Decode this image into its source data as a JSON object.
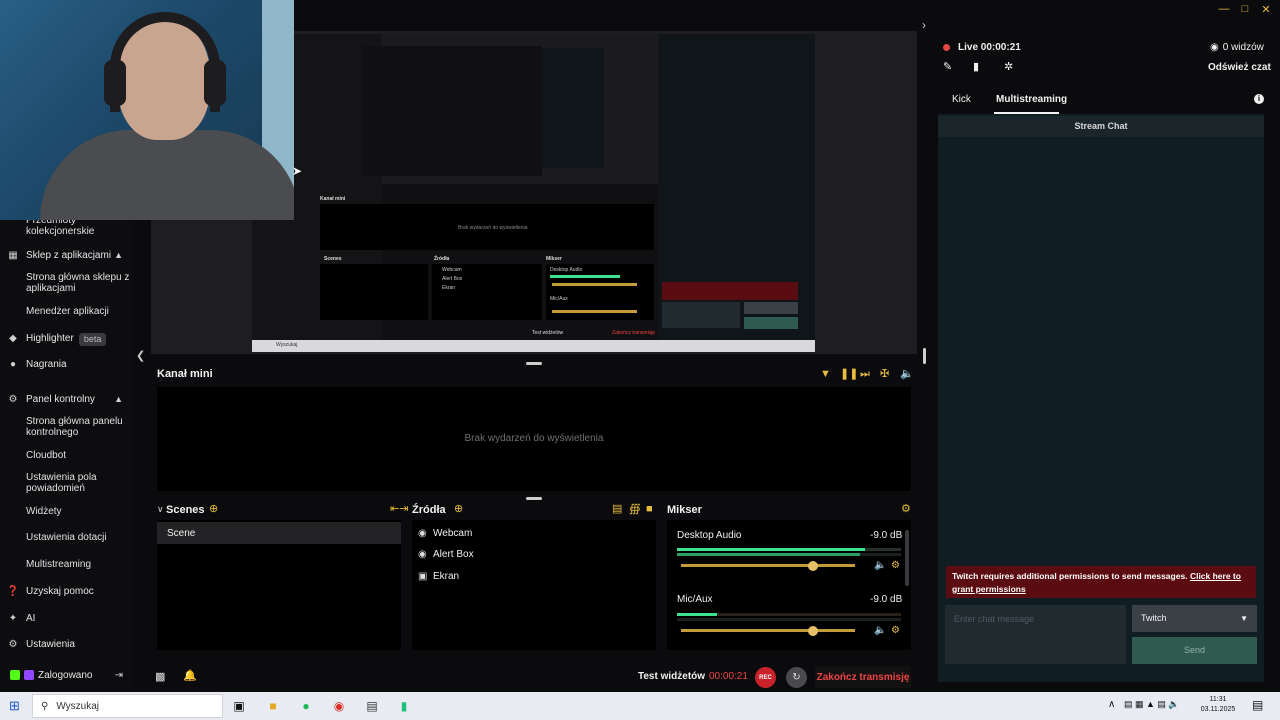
{
  "sidebar": {
    "items": [
      {
        "label": "Przedmioty kolekcjonerskie",
        "icon": "",
        "sub": true
      },
      {
        "label": "Sklep z aplikacjami",
        "icon": "store-icon",
        "sub": false,
        "expanded": true
      },
      {
        "label": "Strona główna sklepu z aplikacjami",
        "sub": true
      },
      {
        "label": "Menedżer aplikacji",
        "sub": true
      },
      {
        "label": "Highlighter",
        "icon": "highlighter-icon",
        "badge": "beta"
      },
      {
        "label": "Nagrania",
        "icon": "recordings-icon"
      },
      {
        "label": "Panel kontrolny",
        "icon": "dashboard-icon",
        "expanded": true
      },
      {
        "label": "Strona główna panelu kontrolnego",
        "sub": true
      },
      {
        "label": "Cloudbot",
        "sub": true
      },
      {
        "label": "Ustawienia pola powiadomień",
        "sub": true
      },
      {
        "label": "Widżety",
        "sub": true
      },
      {
        "label": "Ustawienia dotacji",
        "sub": true
      },
      {
        "label": "Multistreaming",
        "sub": true
      },
      {
        "label": "Uzyskaj pomoc",
        "icon": "help-icon"
      },
      {
        "label": "AI",
        "icon": "ai-icon"
      },
      {
        "label": "Ustawienia",
        "icon": "gear-icon"
      },
      {
        "label": "Zalogowano",
        "icon": "login-icon"
      }
    ]
  },
  "events": {
    "title": "Kanał mini",
    "empty": "Brak wydarzeń do wyświetlenia"
  },
  "scenes": {
    "title": "Scenes",
    "items": [
      "Scene"
    ]
  },
  "sources": {
    "title": "Źródła",
    "items": [
      {
        "label": "Webcam",
        "icon": "webcam-icon"
      },
      {
        "label": "Alert Box",
        "icon": "alertbox-icon"
      },
      {
        "label": "Ekran",
        "icon": "monitor-icon"
      }
    ]
  },
  "mixer": {
    "title": "Mikser",
    "channels": [
      {
        "name": "Desktop Audio",
        "db": "-9.0 dB",
        "level": 0.84,
        "volume": 0.76
      },
      {
        "name": "Mic/Aux",
        "db": "-9.0 dB",
        "level": 0.18,
        "volume": 0.76
      }
    ]
  },
  "status": {
    "test_widgets": "Test widżetów",
    "timer": "00:00:21",
    "rec": "REC",
    "end_stream": "Zakończ transmisję"
  },
  "chat": {
    "live": "Live 00:00:21",
    "viewers": "0 widzów",
    "refresh": "Odśwież czat",
    "tabs": [
      "Kick",
      "Multistreaming"
    ],
    "header": "Stream Chat",
    "permission_text": "Twitch requires additional permissions to send messages.",
    "permission_link": "Click here to grant permissions",
    "input_placeholder": "Enter chat message",
    "platform": "Twitch",
    "send": "Send"
  },
  "preview": {
    "inner_title": "Kanał mini",
    "inner_empty": "Brak wydarzeń do wyświetlenia",
    "inner_scenes": "Scenes",
    "inner_sources": "Źródła",
    "inner_mixer": "Mikser",
    "inner_source_items": [
      "Webcam",
      "Alert Box",
      "Ekran"
    ],
    "inner_desktop": "Desktop Audio",
    "inner_mic": "Mic/Aux",
    "inner_test": "Test widżetów",
    "inner_end": "Zakończ transmisję",
    "inner_search": "Wyszukaj"
  },
  "taskbar": {
    "search": "Wyszukaj",
    "time": "11:31",
    "date": "03.11.2025"
  },
  "colors": {
    "accent": "#e8bc3c",
    "live": "#e64545",
    "meter": "#3de08d",
    "chat_bg": "#101d23"
  }
}
